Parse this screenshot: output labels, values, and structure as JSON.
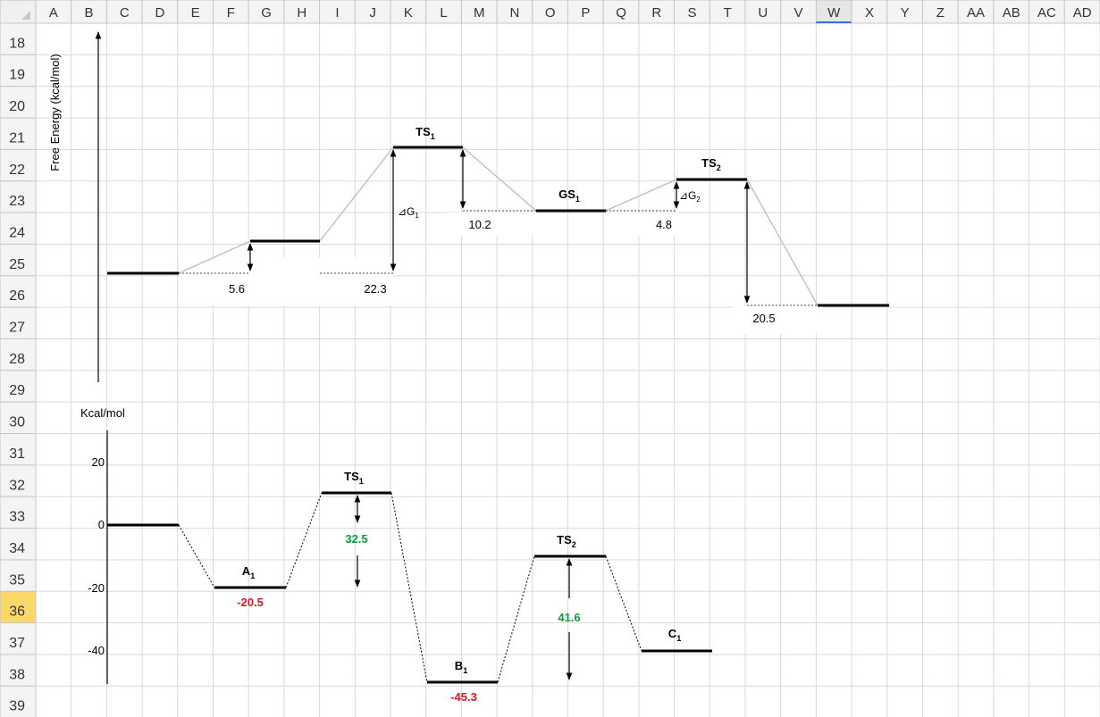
{
  "spreadsheet": {
    "columns": [
      "A",
      "B",
      "C",
      "D",
      "E",
      "F",
      "G",
      "H",
      "I",
      "J",
      "K",
      "L",
      "M",
      "N",
      "O",
      "P",
      "Q",
      "R",
      "S",
      "T",
      "U",
      "V",
      "W",
      "X",
      "Y",
      "Z",
      "AA",
      "AB",
      "AC",
      "AD"
    ],
    "rows": [
      "18",
      "19",
      "20",
      "21",
      "22",
      "23",
      "24",
      "25",
      "26",
      "27",
      "28",
      "29",
      "30",
      "31",
      "32",
      "33",
      "34",
      "35",
      "36",
      "37",
      "38",
      "39"
    ],
    "selected_column": "W",
    "selected_row": "36"
  },
  "chart_top": {
    "ylabel": "Free Energy (kcal/mol)",
    "labels": {
      "ts1": "TS",
      "gs1": "GS",
      "ts2": "TS",
      "sub1": "1",
      "sub2": "2",
      "dg1": "⊿G",
      "dg2": "⊿G"
    },
    "values": {
      "v1": "5.6",
      "v2": "22.3",
      "v3": "10.2",
      "v4": "4.8",
      "v5": "20.5"
    }
  },
  "chart_bottom": {
    "unit_label": "Kcal/mol",
    "yticks": [
      "20",
      "0",
      "-20",
      "-40"
    ],
    "labels": {
      "ts1": "TS",
      "a1": "A",
      "b1": "B",
      "ts2": "TS",
      "c1": "C",
      "sub1": "1",
      "sub2": "2"
    },
    "values": {
      "a1": "-20.5",
      "b1": "-45.3",
      "gap1": "32.5",
      "gap2": "41.6"
    },
    "colors": {
      "negative": "#e8141c",
      "barrier": "#0a9e3c"
    }
  }
}
